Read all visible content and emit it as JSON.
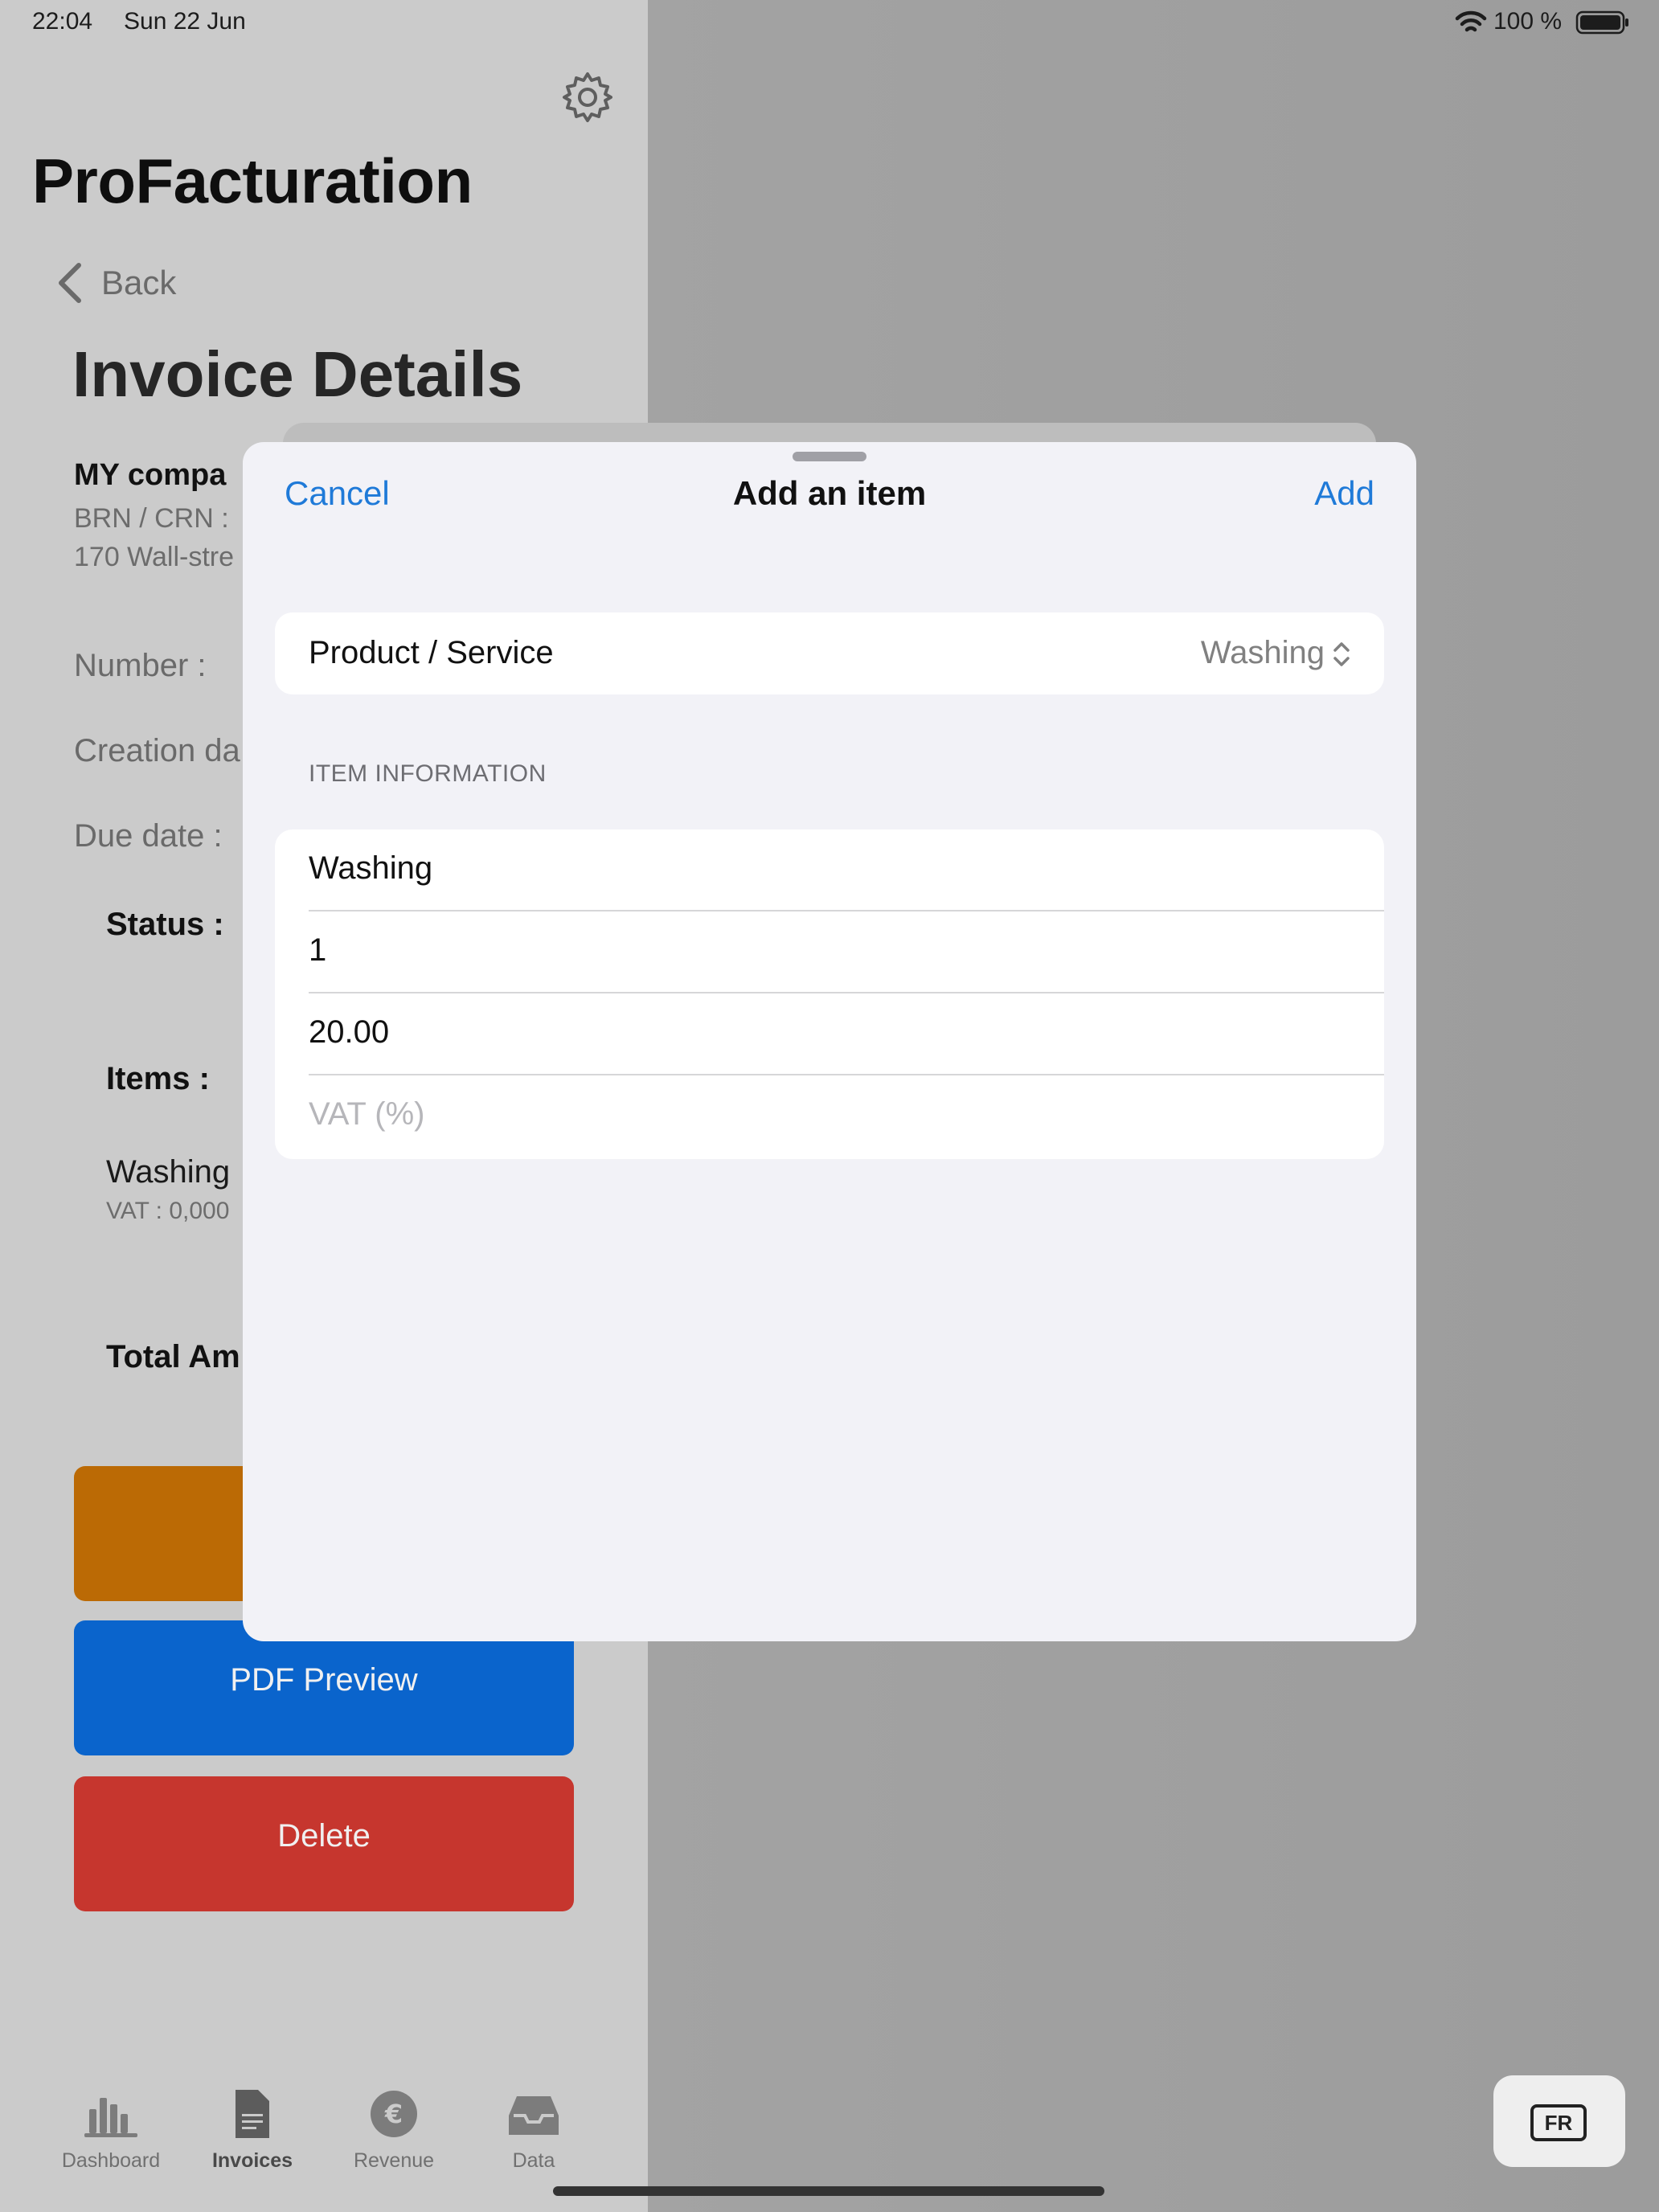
{
  "status_bar": {
    "time": "22:04",
    "date": "Sun 22 Jun",
    "battery": "100 %"
  },
  "sidebar": {
    "app_title": "ProFacturation",
    "back_label": "Back",
    "page_title": "Invoice Details",
    "company": {
      "name": "MY compa",
      "brn": "BRN / CRN :",
      "address": "170 Wall-stre"
    },
    "number_label": "Number :",
    "creation_label": "Creation da",
    "due_label": "Due date :",
    "status_label": "Status :",
    "items_label": "Items :",
    "item_name": "Washing",
    "item_vat": "VAT : 0,000",
    "total_label": "Total Am",
    "orange_button_label": "",
    "pdf_preview_label": "PDF Preview",
    "delete_label": "Delete"
  },
  "tabbar": {
    "tabs": [
      {
        "label": "Dashboard",
        "icon": "chart-bar-icon"
      },
      {
        "label": "Invoices",
        "icon": "document-icon"
      },
      {
        "label": "Revenue",
        "icon": "euro-icon"
      },
      {
        "label": "Data",
        "icon": "tray-icon"
      }
    ],
    "active": "Invoices"
  },
  "keyboard_button": {
    "label": "FR"
  },
  "sheet": {
    "cancel_label": "Cancel",
    "title": "Add an item",
    "add_label": "Add",
    "product_label": "Product / Service",
    "product_value": "Washing",
    "section_header": "ITEM INFORMATION",
    "name_value": "Washing",
    "quantity_value": "1",
    "price_value": "20.00",
    "vat_placeholder": "VAT (%)"
  },
  "colors": {
    "accent": "#1f7ad8",
    "orange": "#bb6a05",
    "blue": "#0a64cc",
    "red": "#c6362e"
  }
}
